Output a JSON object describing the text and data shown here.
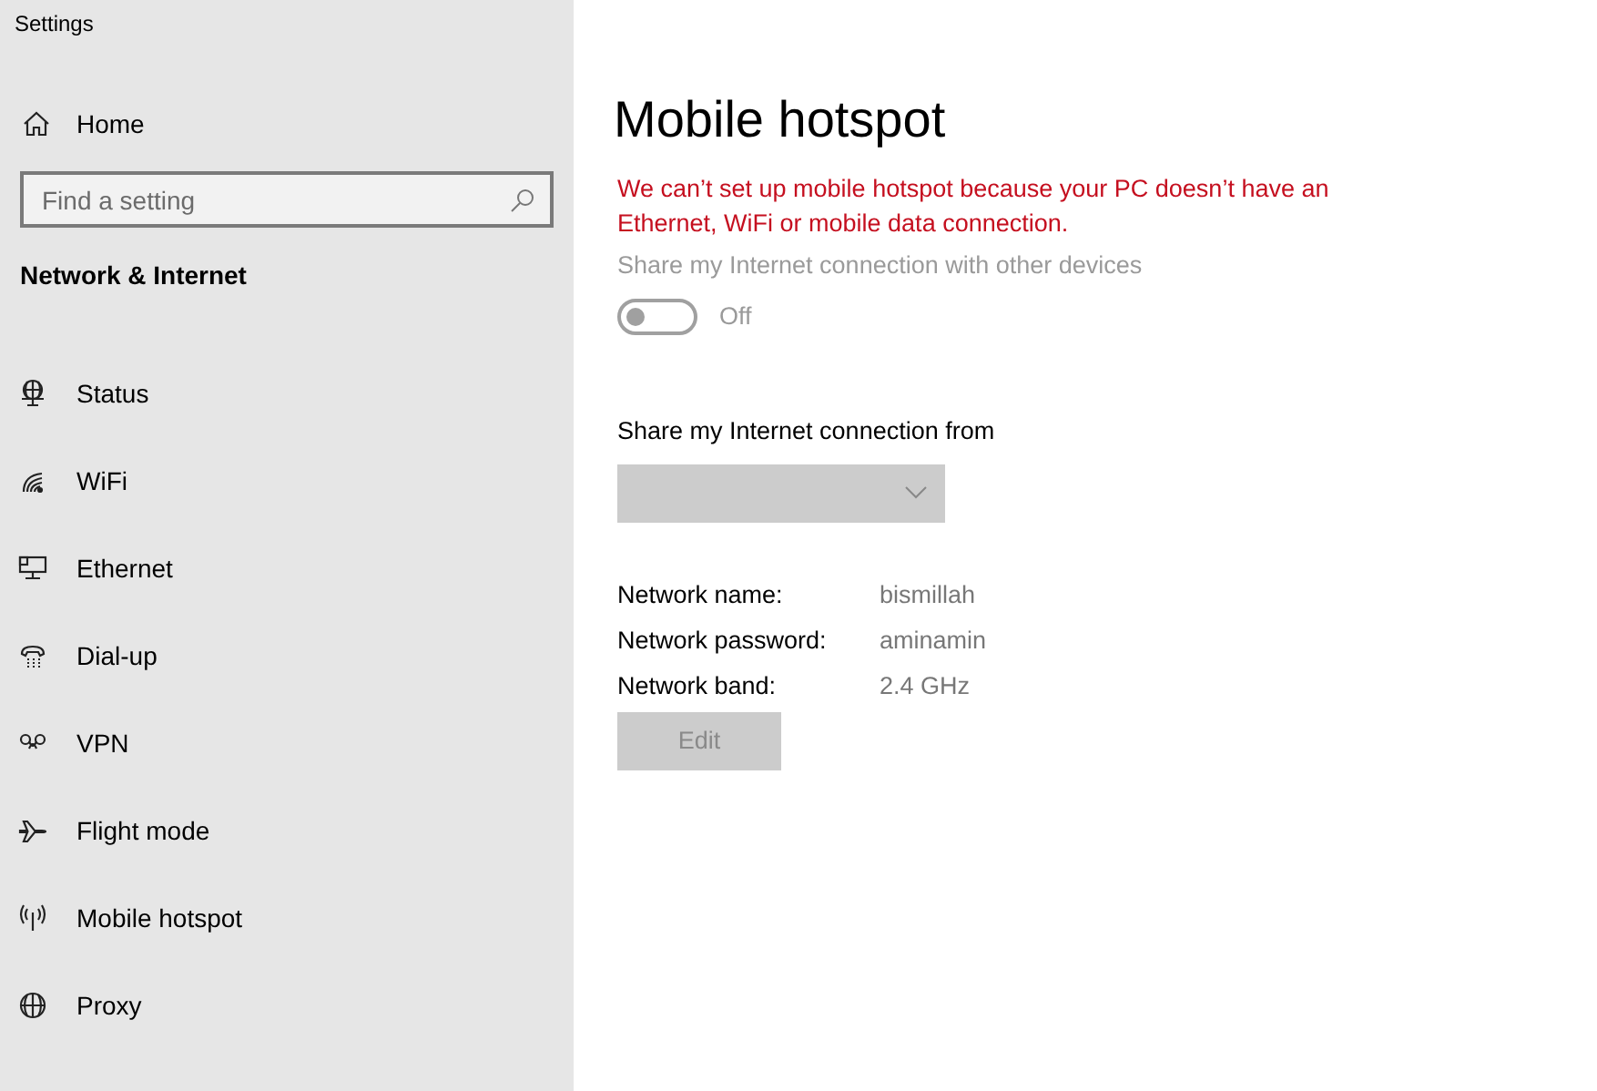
{
  "window": {
    "title": "Settings"
  },
  "sidebar": {
    "home": "Home",
    "search": {
      "placeholder": "Find a setting"
    },
    "section": "Network & Internet",
    "items": [
      {
        "kind": "status",
        "label": "Status"
      },
      {
        "kind": "wifi",
        "label": "WiFi"
      },
      {
        "kind": "ethernet",
        "label": "Ethernet"
      },
      {
        "kind": "dialup",
        "label": "Dial-up"
      },
      {
        "kind": "vpn",
        "label": "VPN"
      },
      {
        "kind": "flight",
        "label": "Flight mode"
      },
      {
        "kind": "hotspot",
        "label": "Mobile hotspot"
      },
      {
        "kind": "proxy",
        "label": "Proxy"
      }
    ]
  },
  "page": {
    "title": "Mobile hotspot",
    "error": "We can’t set up mobile hotspot because your PC doesn’t have an Ethernet, WiFi or mobile data connection.",
    "share_label": "Share my Internet connection with other devices",
    "toggle": {
      "on": false,
      "label": "Off"
    },
    "share_from_label": "Share my Internet connection from",
    "details": [
      {
        "label": "Network name:",
        "value": "bismillah"
      },
      {
        "label": "Network password:",
        "value": "aminamin"
      },
      {
        "label": "Network band:",
        "value": "2.4 GHz"
      }
    ],
    "edit_button": {
      "label": "Edit",
      "disabled": true
    }
  }
}
